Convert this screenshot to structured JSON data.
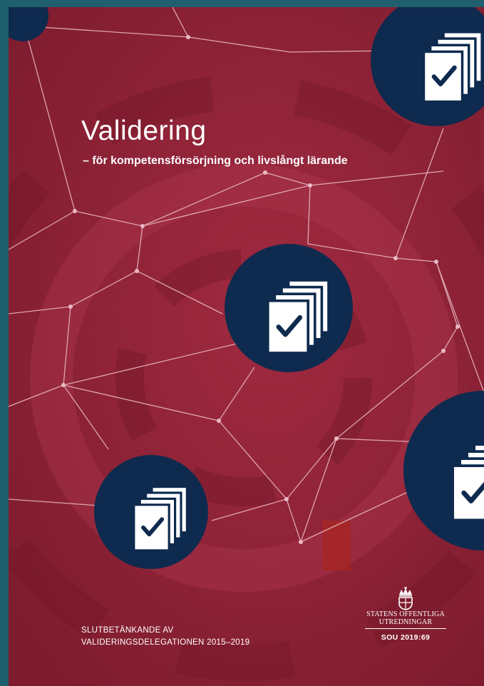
{
  "cover": {
    "title": "Validering",
    "subtitle": "– för kompetensförsörjning och livslångt lärande",
    "report_line_1": "SLUTBETÄNKANDE AV",
    "report_line_2": "VALIDERINGSDELEGATIONEN 2015–2019",
    "publisher_line_1": "STATENS OFFENTLIGA",
    "publisher_line_2": "UTREDNINGAR",
    "series_number": "SOU 2019:69"
  },
  "colors": {
    "frame": "#1f5f6e",
    "cover_background": "#8d2236",
    "badge_navy": "#0e2a4e",
    "text": "#ffffff"
  },
  "icons": [
    "document-stack-check-icon",
    "crown-logo-icon"
  ]
}
